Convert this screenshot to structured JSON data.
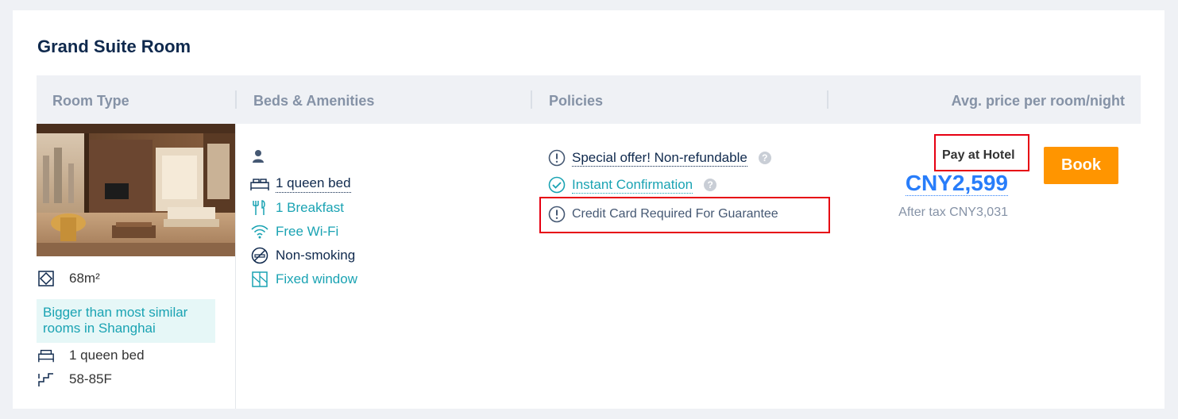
{
  "room": {
    "title": "Grand Suite Room",
    "size": "68m²",
    "highlight": "Bigger than most similar rooms in Shanghai",
    "bed": "1 queen bed",
    "floor": "58-85F"
  },
  "table_header": {
    "room_type": "Room Type",
    "beds_amenities": "Beds & Amenities",
    "policies": "Policies",
    "avg_price": "Avg. price per room/night"
  },
  "amenities": [
    {
      "label": "1 queen bed",
      "icon": "bed-icon",
      "color": "#0f294d"
    },
    {
      "label": "1 Breakfast",
      "icon": "breakfast-icon",
      "color": "#1aa3b3"
    },
    {
      "label": "Free Wi-Fi",
      "icon": "wifi-icon",
      "color": "#1aa3b3"
    },
    {
      "label": "Non-smoking",
      "icon": "no-smoking-icon",
      "color": "#0f294d"
    },
    {
      "label": "Fixed window",
      "icon": "window-icon",
      "color": "#1aa3b3"
    }
  ],
  "policies": [
    {
      "label": "Special offer! Non-refundable",
      "icon": "info-circle-icon"
    },
    {
      "label": "Instant Confirmation",
      "icon": "check-circle-icon"
    },
    {
      "label": "Credit Card Required For Guarantee",
      "icon": "info-circle-icon"
    }
  ],
  "pricing": {
    "payment": "Pay at Hotel",
    "price": "CNY2,599",
    "after_tax": "After tax CNY3,031",
    "book_label": "Book"
  },
  "colors": {
    "accent": "#287dfa",
    "teal": "#1aa3b3",
    "book": "#ff9500",
    "highlight_box": "#e60012"
  }
}
